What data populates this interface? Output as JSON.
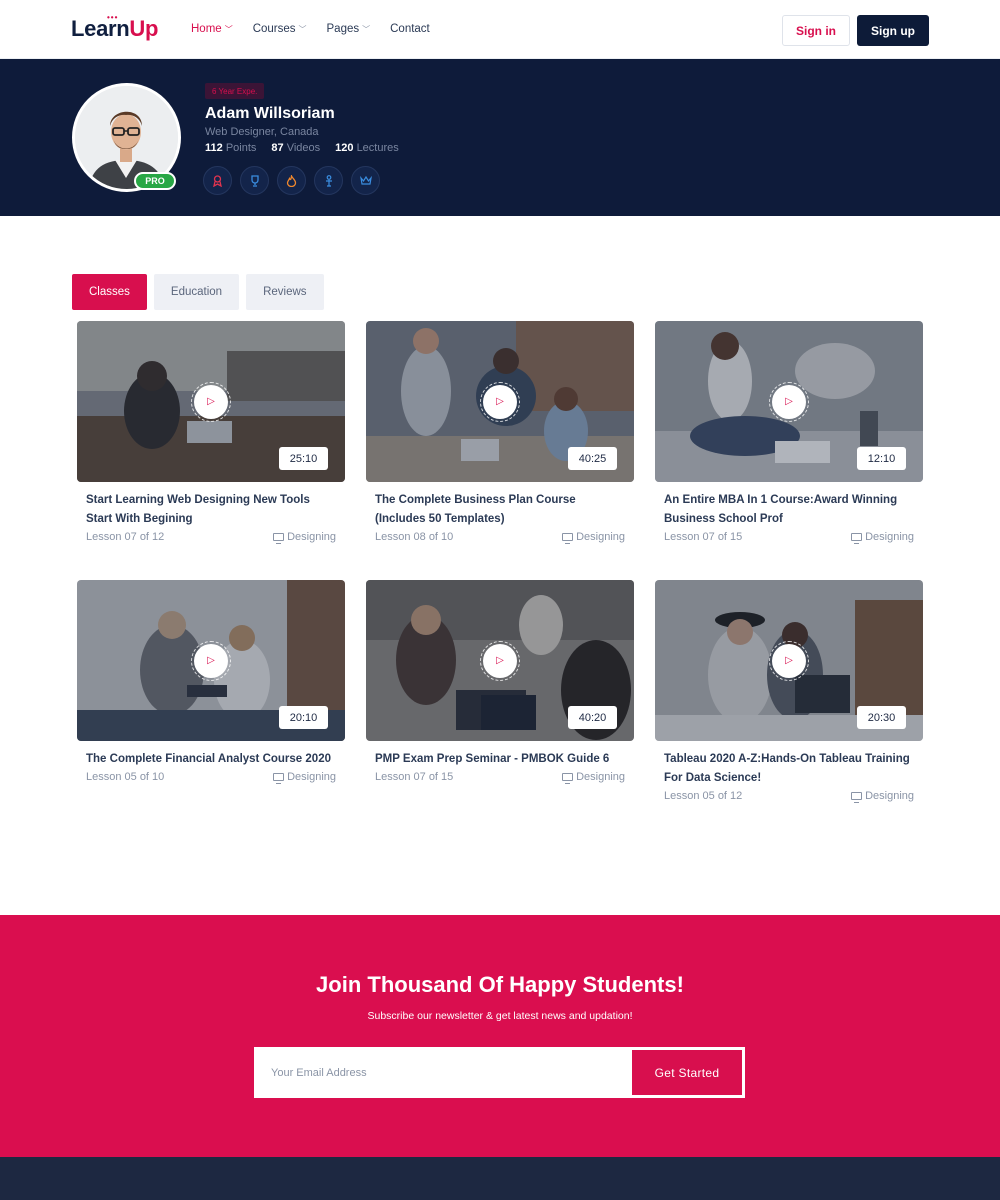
{
  "nav": {
    "logo_part1": "Learn",
    "logo_part2": "Up",
    "menu": [
      {
        "label": "Home"
      },
      {
        "label": "Courses"
      },
      {
        "label": "Pages"
      },
      {
        "label": "Contact"
      }
    ],
    "signin": "Sign in",
    "signup": "Sign up"
  },
  "profile": {
    "experience": "6 Year Expe.",
    "name": "Adam Willsoriam",
    "role": "Web Designer, Canada",
    "points_value": "112",
    "points_label": "Points",
    "videos_value": "87",
    "videos_label": "Videos",
    "lectures_value": "120",
    "lectures_label": "Lectures",
    "pro_badge": "PRO",
    "badge_icons": [
      "ribbon-icon",
      "trophy-icon",
      "fire-icon",
      "person-icon",
      "crown-icon"
    ]
  },
  "tabs": [
    {
      "label": "Classes"
    },
    {
      "label": "Education"
    },
    {
      "label": "Reviews"
    }
  ],
  "courses": [
    {
      "title": "Start Learning Web Designing New Tools Start With Begining",
      "duration": "25:10",
      "lesson": "Lesson 07 of 12",
      "category": "Designing"
    },
    {
      "title": "The Complete Business Plan Course (Includes 50 Templates)",
      "duration": "40:25",
      "lesson": "Lesson 08 of 10",
      "category": "Designing"
    },
    {
      "title": "An Entire MBA In 1 Course:Award Winning Business School Prof",
      "duration": "12:10",
      "lesson": "Lesson 07 of 15",
      "category": "Designing"
    },
    {
      "title": "The Complete Financial Analyst Course 2020",
      "duration": "20:10",
      "lesson": "Lesson 05 of 10",
      "category": "Designing"
    },
    {
      "title": "PMP Exam Prep Seminar - PMBOK Guide 6",
      "duration": "40:20",
      "lesson": "Lesson 07 of 15",
      "category": "Designing"
    },
    {
      "title": "Tableau 2020 A-Z:Hands-On Tableau Training For Data Science!",
      "duration": "20:30",
      "lesson": "Lesson 05 of 12",
      "category": "Designing"
    }
  ],
  "newsletter": {
    "title": "Join Thousand Of Happy Students!",
    "subtitle": "Subscribe our newsletter & get latest news and updation!",
    "placeholder": "Your Email Address",
    "button": "Get Started"
  },
  "colors": {
    "accent": "#d80f4e",
    "navy": "#0e1b3a",
    "pro_green": "#28a745"
  }
}
